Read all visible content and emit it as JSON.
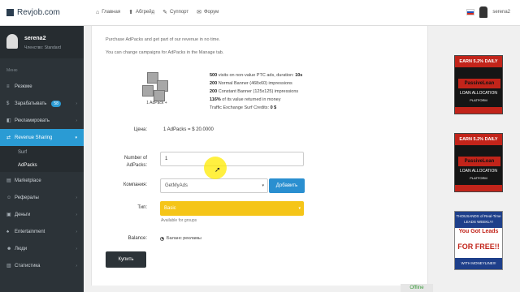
{
  "site": {
    "logo_text": "Revjob.com"
  },
  "topnav": [
    {
      "label": "Главная",
      "icon": "home-icon"
    },
    {
      "label": "Абгрейд",
      "icon": "upgrade-icon"
    },
    {
      "label": "Суппорт",
      "icon": "support-icon"
    },
    {
      "label": "Форум",
      "icon": "forum-icon"
    }
  ],
  "sidebar": {
    "profile": {
      "name": "serena2",
      "status": "Членство: Standard"
    },
    "heading": "Меню",
    "items": [
      {
        "label": "Резюме",
        "icon": "dashboard-icon"
      },
      {
        "label": "Зарабатывать",
        "icon": "dollar-icon",
        "badge": "58"
      },
      {
        "label": "Рекламировать",
        "icon": "megaphone-icon"
      },
      {
        "label": "Revenue Sharing",
        "icon": "share-icon",
        "active": true
      },
      {
        "label": "Marketplace",
        "icon": "cart-icon"
      },
      {
        "label": "Рефералы",
        "icon": "users-icon"
      },
      {
        "label": "Деньги",
        "icon": "wallet-icon"
      },
      {
        "label": "Entertainment",
        "icon": "game-icon"
      },
      {
        "label": "Люди",
        "icon": "people-icon"
      },
      {
        "label": "Статистика",
        "icon": "stats-icon"
      }
    ],
    "subitems": [
      {
        "label": "Surf"
      },
      {
        "label": "AdPacks"
      }
    ]
  },
  "main": {
    "intro1": "Purchase AdPacks and get part of our revenue in no time.",
    "intro2": "You can change campaigns for AdPacks in the Manage tab.",
    "pack_label": "1 AdPack +",
    "features": [
      {
        "strong": "500",
        "text": " visits on non-value PTC ads, duration: ",
        "strong2": "10s"
      },
      {
        "strong": "200",
        "text": " Normal Banner (468x60) impressions"
      },
      {
        "strong": "200",
        "text": " Constant Banner (125x125) impressions"
      },
      {
        "strong": "116%",
        "text": " of its value returned in money"
      },
      {
        "strong": "",
        "text": "Traffic Exchange Surf Credits: ",
        "strong2": "0 $"
      }
    ],
    "price_label": "Цена:",
    "price_value": "1 AdPacks = $ 20.0000",
    "number_label_1": "Number of",
    "number_label_2": "AdPacks:",
    "number_value": "1",
    "campaign_label": "Компания:",
    "campaign_value": "GetMyAds",
    "add_button": "Добавить",
    "type_label": "Тип:",
    "type_value": "Basic",
    "available_text": "Available for groups",
    "balance_label": "Balance:",
    "balance_option": "Баланс рекламы",
    "buy_button": "Купить"
  },
  "ads": {
    "banner_top": "EARN 5.2% DAILY",
    "banner_brand": "PassiveLoan",
    "banner_sub": "LOAN ALLOCATION",
    "banner_plat": "PLATFORM",
    "banner2_top": "THOUSANDS of Real-Time LEADS WEEKLY!",
    "banner2_brand": "You Got Leads",
    "banner2_free": "FOR FREE!!",
    "banner2_foot": "WITH MONEYLINE!!!"
  },
  "chat": {
    "status": "Offline"
  }
}
